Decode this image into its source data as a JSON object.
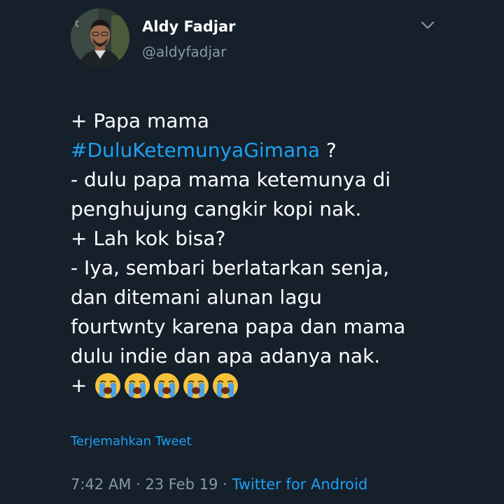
{
  "author": {
    "display_name": "Aldy Fadjar",
    "handle": "@aldyfadjar"
  },
  "menu_icon": "chevron-down-icon",
  "tweet": {
    "lines": [
      "+ Papa mama",
      "#DuluKetemunyaGimana",
      " ?",
      "- dulu papa mama ketemunya di",
      "penghujung cangkir kopi nak.",
      "+ Lah kok bisa?",
      "- Iya, sembari berlatarkan senja,",
      "dan ditemani alunan lagu",
      "fourtwnty karena papa dan mama",
      "dulu indie dan apa adanya nak.",
      "+"
    ],
    "emoji": [
      "loudly-crying-face-icon",
      "loudly-crying-face-icon",
      "loudly-crying-face-icon",
      "loudly-crying-face-icon",
      "loudly-crying-face-icon"
    ]
  },
  "translate_label": "Terjemahkan Tweet",
  "meta": {
    "time": "7:42 AM",
    "sep1": " · ",
    "date": "23 Feb 19",
    "sep2": " · ",
    "source": "Twitter for Android"
  },
  "colors": {
    "background": "#15202b",
    "link": "#1da1f2",
    "secondary_text": "#8899a6"
  }
}
